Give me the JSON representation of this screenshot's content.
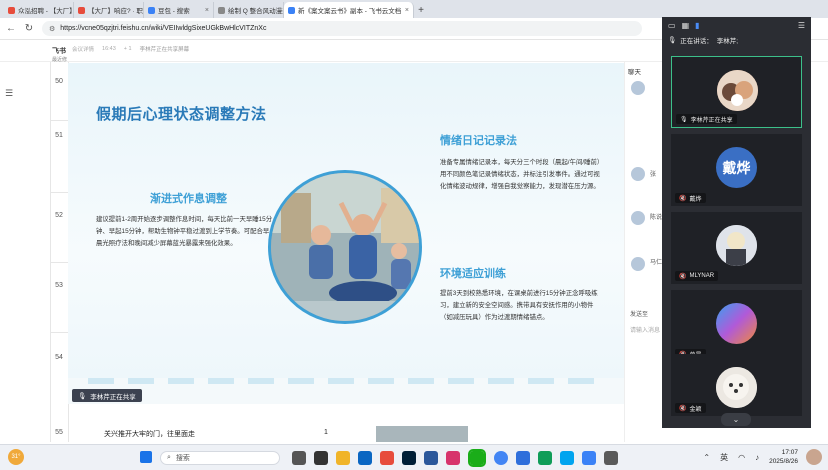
{
  "browser": {
    "tabs": [
      {
        "label": "众泓招聘 - 【大厂】响应?·职",
        "color": "#e74c3c",
        "active": false
      },
      {
        "label": "【大厂】响应? · 职",
        "color": "#e74c3c",
        "active": false
      },
      {
        "label": "豆包 - 搜索",
        "color": "#3b82f6",
        "active": false
      },
      {
        "label": "绘制 Q 整合风动漫美词 - 豆包",
        "color": "#888888",
        "active": false
      },
      {
        "label": "新《案文案云书》副本 - 飞书云文档",
        "color": "#3b82f6",
        "active": true
      }
    ],
    "new_tab": "+",
    "url": "https://vcne05qzjtri.feishu.cn/wiki/VEIIwldgSixeUGkBwHlcVITZnXc"
  },
  "doc": {
    "left_label": "飞书",
    "left_sub": "最近修",
    "meeting_status": "会议详情",
    "meeting_time": "16:43",
    "participants_count": "+ 1",
    "sharing_text": "李林芹正在共享屏幕"
  },
  "sheet": {
    "rows": [
      "50",
      "51",
      "52",
      "53",
      "54",
      "55"
    ],
    "row55_text": "关兴推开大牢的门，往里面走",
    "row55_num": "1"
  },
  "slide": {
    "title": "假期后心理状态调整方法",
    "sections": [
      {
        "title": "渐进式作息调整",
        "body": "建议提前1-2周开始逐步调整作息时间，每天比前一天早睡15分钟、早起15分钟，帮助生物钟平稳过渡到上学节奏。可配合早晨光照疗法和晚间减少屏幕蓝光暴露来强化效果。"
      },
      {
        "title": "情绪日记记录法",
        "body": "准备专属情绪记录本，每天分三个时段（晨起/午间/睡前）用不同颜色笔记录情绪状态，并标注引发事件。通过可视化情绪波动规律，增强自我觉察能力，发现潜在压力源。"
      },
      {
        "title": "环境适应训练",
        "body": "提前3天到校熟悉环境，在课桌前进行15分钟正念呼吸练习，建立新的安全空间感。携带具有安抚作用的小物件（如减压玩具）作为过渡期情绪锚点。"
      }
    ],
    "share_label": "李林芹正在共享"
  },
  "meeting": {
    "speaking_label": "正在讲话：",
    "speaking_name": "李林芹;",
    "participants": [
      {
        "name": "李林芹正在共享",
        "avatar_text": "",
        "color": "#c98b6a",
        "active": true
      },
      {
        "name": "戴烨",
        "avatar_text": "戴烨",
        "color": "#3a6fc4",
        "active": false
      },
      {
        "name": "MLYNAR",
        "avatar_text": "",
        "color": "#c9cfd8",
        "active": false
      },
      {
        "name": "曾晨",
        "avatar_text": "",
        "color": "#7a6ad8",
        "active": false
      },
      {
        "name": "金颖",
        "avatar_text": "",
        "color": "#e8e4e0",
        "active": false
      }
    ]
  },
  "chat": {
    "header": "聊天",
    "names": [
      "张",
      "陈说",
      "马仁"
    ],
    "send_label": "发送至",
    "input_placeholder": "请输入消息"
  },
  "taskbar": {
    "search_placeholder": "搜索",
    "ime": "英",
    "time": "17:07",
    "date": "2025/8/26",
    "weather": "31°"
  }
}
